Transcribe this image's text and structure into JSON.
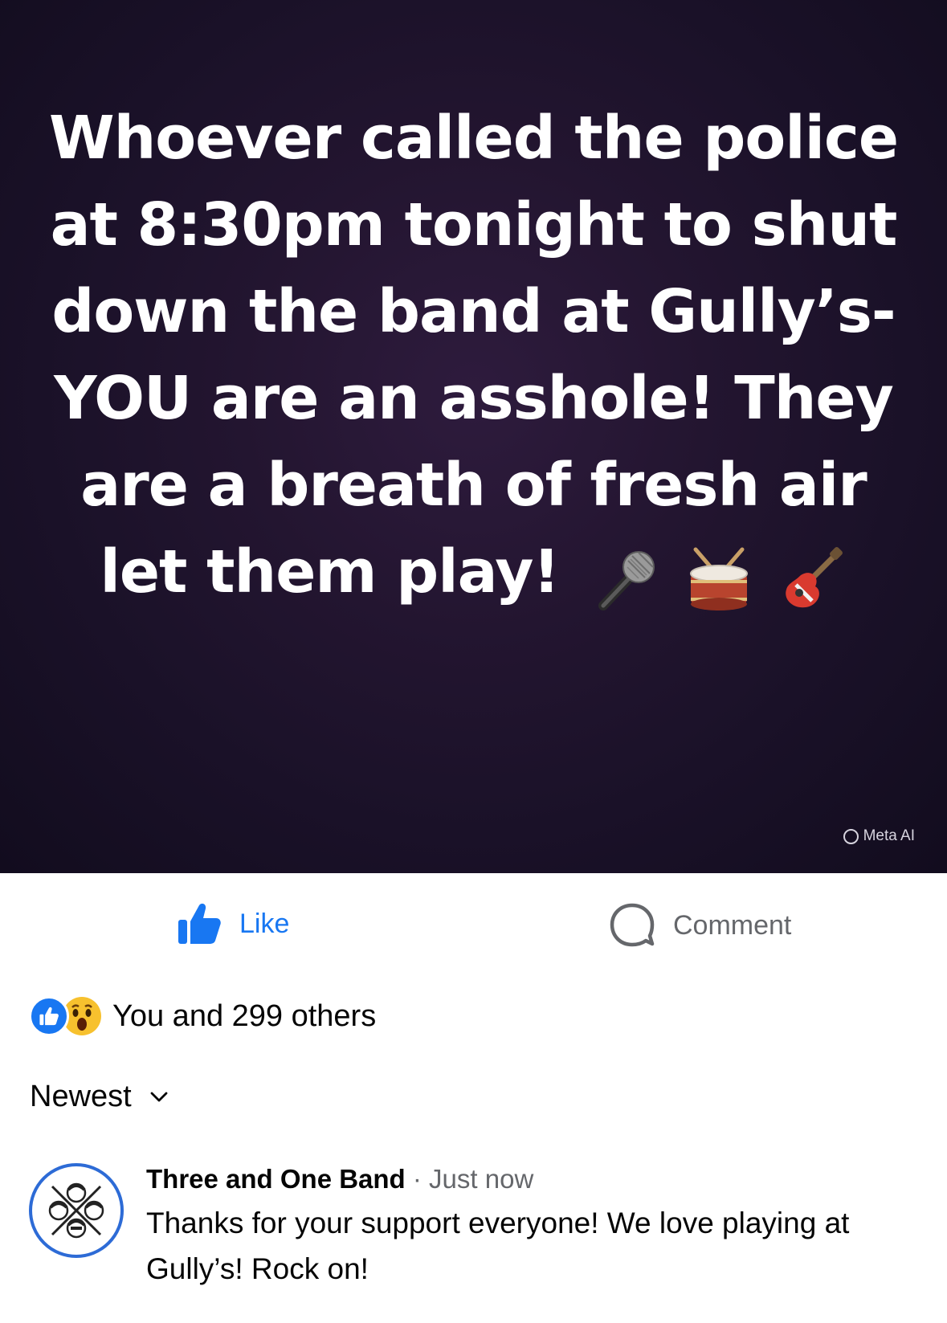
{
  "post": {
    "text": "Whoever called the police at 8:30pm tonight to shut down the band at Gully’s- YOU are an asshole! They are a breath of fresh air let them play!",
    "emojis": [
      "microphone-icon",
      "drum-icon",
      "guitar-icon"
    ],
    "watermark": "Meta AI"
  },
  "actions": {
    "like_label": "Like",
    "comment_label": "Comment"
  },
  "reactions": {
    "icons": [
      "like-reaction-icon",
      "wow-reaction-icon"
    ],
    "summary": "You and 299 others"
  },
  "comments_sort": {
    "selected": "Newest"
  },
  "comments": [
    {
      "author": "Three and One Band",
      "separator": " · ",
      "time": "Just now",
      "text": "Thanks for your support everyone! We love playing at Gully’s! Rock on!"
    }
  ],
  "colors": {
    "accent": "#1877f2",
    "muted": "#65676b",
    "post_background": "#1c1229"
  }
}
